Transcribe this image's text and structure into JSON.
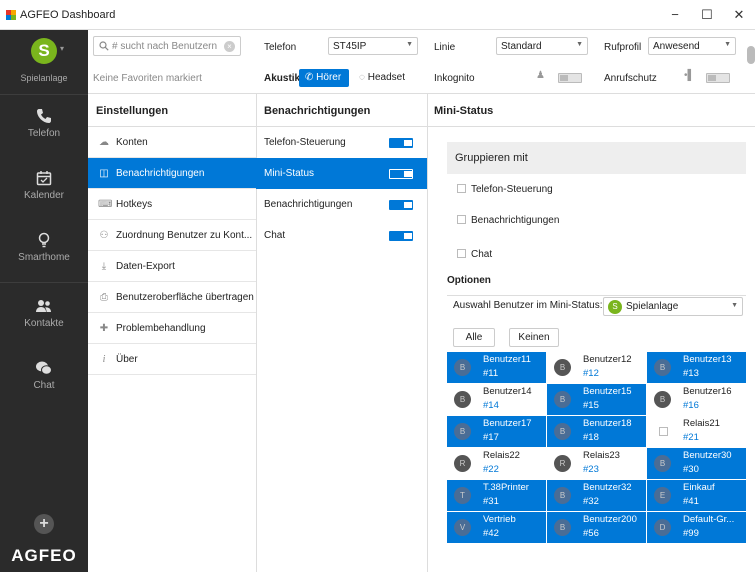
{
  "window": {
    "title": "AGFEO Dashboard",
    "minimize": "−",
    "maximize": "☐",
    "close": "✕"
  },
  "sidebar": {
    "avatar_initial": "S",
    "user_name": "Spielanlage",
    "items": [
      {
        "label": "Telefon",
        "icon": "phone-icon"
      },
      {
        "label": "Kalender",
        "icon": "calendar-icon"
      },
      {
        "label": "Smarthome",
        "icon": "lightbulb-icon"
      },
      {
        "label": "Kontakte",
        "icon": "contacts-icon"
      },
      {
        "label": "Chat",
        "icon": "chat-icon"
      }
    ],
    "add": "+",
    "brand": "AGFEO"
  },
  "toolbar": {
    "search_placeholder": "# sucht nach Benutzern",
    "no_favorites": "Keine Favoriten markiert",
    "telefon_label": "Telefon",
    "telefon_value": "ST45IP",
    "linie_label": "Linie",
    "linie_value": "Standard",
    "rufprofil_label": "Rufprofil",
    "rufprofil_value": "Anwesend",
    "akustik_label": "Akustik",
    "hoerer_label": "Hörer",
    "headset_label": "Headset",
    "inkognito_label": "Inkognito",
    "anrufschutz_label": "Anrufschutz"
  },
  "settings": {
    "title": "Einstellungen",
    "items": [
      {
        "label": "Konten",
        "icon": "cloud-icon",
        "glyph": "☁"
      },
      {
        "label": "Benachrichtigungen",
        "icon": "notification-icon",
        "glyph": "◫"
      },
      {
        "label": "Hotkeys",
        "icon": "keyboard-icon",
        "glyph": "⌨"
      },
      {
        "label": "Zuordnung Benutzer zu Kont...",
        "icon": "users-assign-icon",
        "glyph": "⚇"
      },
      {
        "label": "Daten-Export",
        "icon": "download-icon",
        "glyph": "⤓"
      },
      {
        "label": "Benutzeroberfläche übertragen",
        "icon": "transfer-icon",
        "glyph": "⎙"
      },
      {
        "label": "Problembehandlung",
        "icon": "puzzle-icon",
        "glyph": "✚"
      },
      {
        "label": "Über",
        "icon": "info-icon",
        "glyph": "i"
      }
    ],
    "selected": 1
  },
  "notifications": {
    "title": "Benachrichtigungen",
    "items": [
      {
        "label": "Telefon-Steuerung",
        "on": true
      },
      {
        "label": "Mini-Status",
        "on": true
      },
      {
        "label": "Benachrichtigungen",
        "on": true
      },
      {
        "label": "Chat",
        "on": true
      }
    ],
    "selected": 1
  },
  "mini_status": {
    "title": "Mini-Status",
    "group_title": "Gruppieren mit",
    "group_options": [
      "Telefon-Steuerung",
      "Benachrichtigungen",
      "Chat"
    ],
    "options_title": "Optionen",
    "auswahl_label": "Auswahl Benutzer im Mini-Status:",
    "auswahl_initial": "S",
    "auswahl_value": "Spielanlage",
    "btn_all": "Alle",
    "btn_none": "Keinen",
    "users": [
      {
        "name": "Benutzer11",
        "id": "#11",
        "initial": "B",
        "on": true
      },
      {
        "name": "Benutzer12",
        "id": "#12",
        "initial": "B",
        "on": false
      },
      {
        "name": "Benutzer13",
        "id": "#13",
        "initial": "B",
        "on": true
      },
      {
        "name": "Benutzer14",
        "id": "#14",
        "initial": "B",
        "on": false
      },
      {
        "name": "Benutzer15",
        "id": "#15",
        "initial": "B",
        "on": true
      },
      {
        "name": "Benutzer16",
        "id": "#16",
        "initial": "B",
        "on": false
      },
      {
        "name": "Benutzer17",
        "id": "#17",
        "initial": "B",
        "on": true
      },
      {
        "name": "Benutzer18",
        "id": "#18",
        "initial": "B",
        "on": true
      },
      {
        "name": "Relais21",
        "id": "#21",
        "initial": "",
        "on": false
      },
      {
        "name": "Relais22",
        "id": "#22",
        "initial": "R",
        "on": false
      },
      {
        "name": "Relais23",
        "id": "#23",
        "initial": "R",
        "on": false
      },
      {
        "name": "Benutzer30",
        "id": "#30",
        "initial": "B",
        "on": true
      },
      {
        "name": "T.38Printer",
        "id": "#31",
        "initial": "T",
        "on": true
      },
      {
        "name": "Benutzer32",
        "id": "#32",
        "initial": "B",
        "on": true
      },
      {
        "name": "Einkauf",
        "id": "#41",
        "initial": "E",
        "on": true
      },
      {
        "name": "Vertrieb",
        "id": "#42",
        "initial": "V",
        "on": true
      },
      {
        "name": "Benutzer200",
        "id": "#56",
        "initial": "B",
        "on": true
      },
      {
        "name": "Default-Gr...",
        "id": "#99",
        "initial": "D",
        "on": true
      }
    ]
  },
  "colors": {
    "accent": "#0078d7",
    "sidebar": "#2b2b2b",
    "avatar": "#7ab51d"
  }
}
